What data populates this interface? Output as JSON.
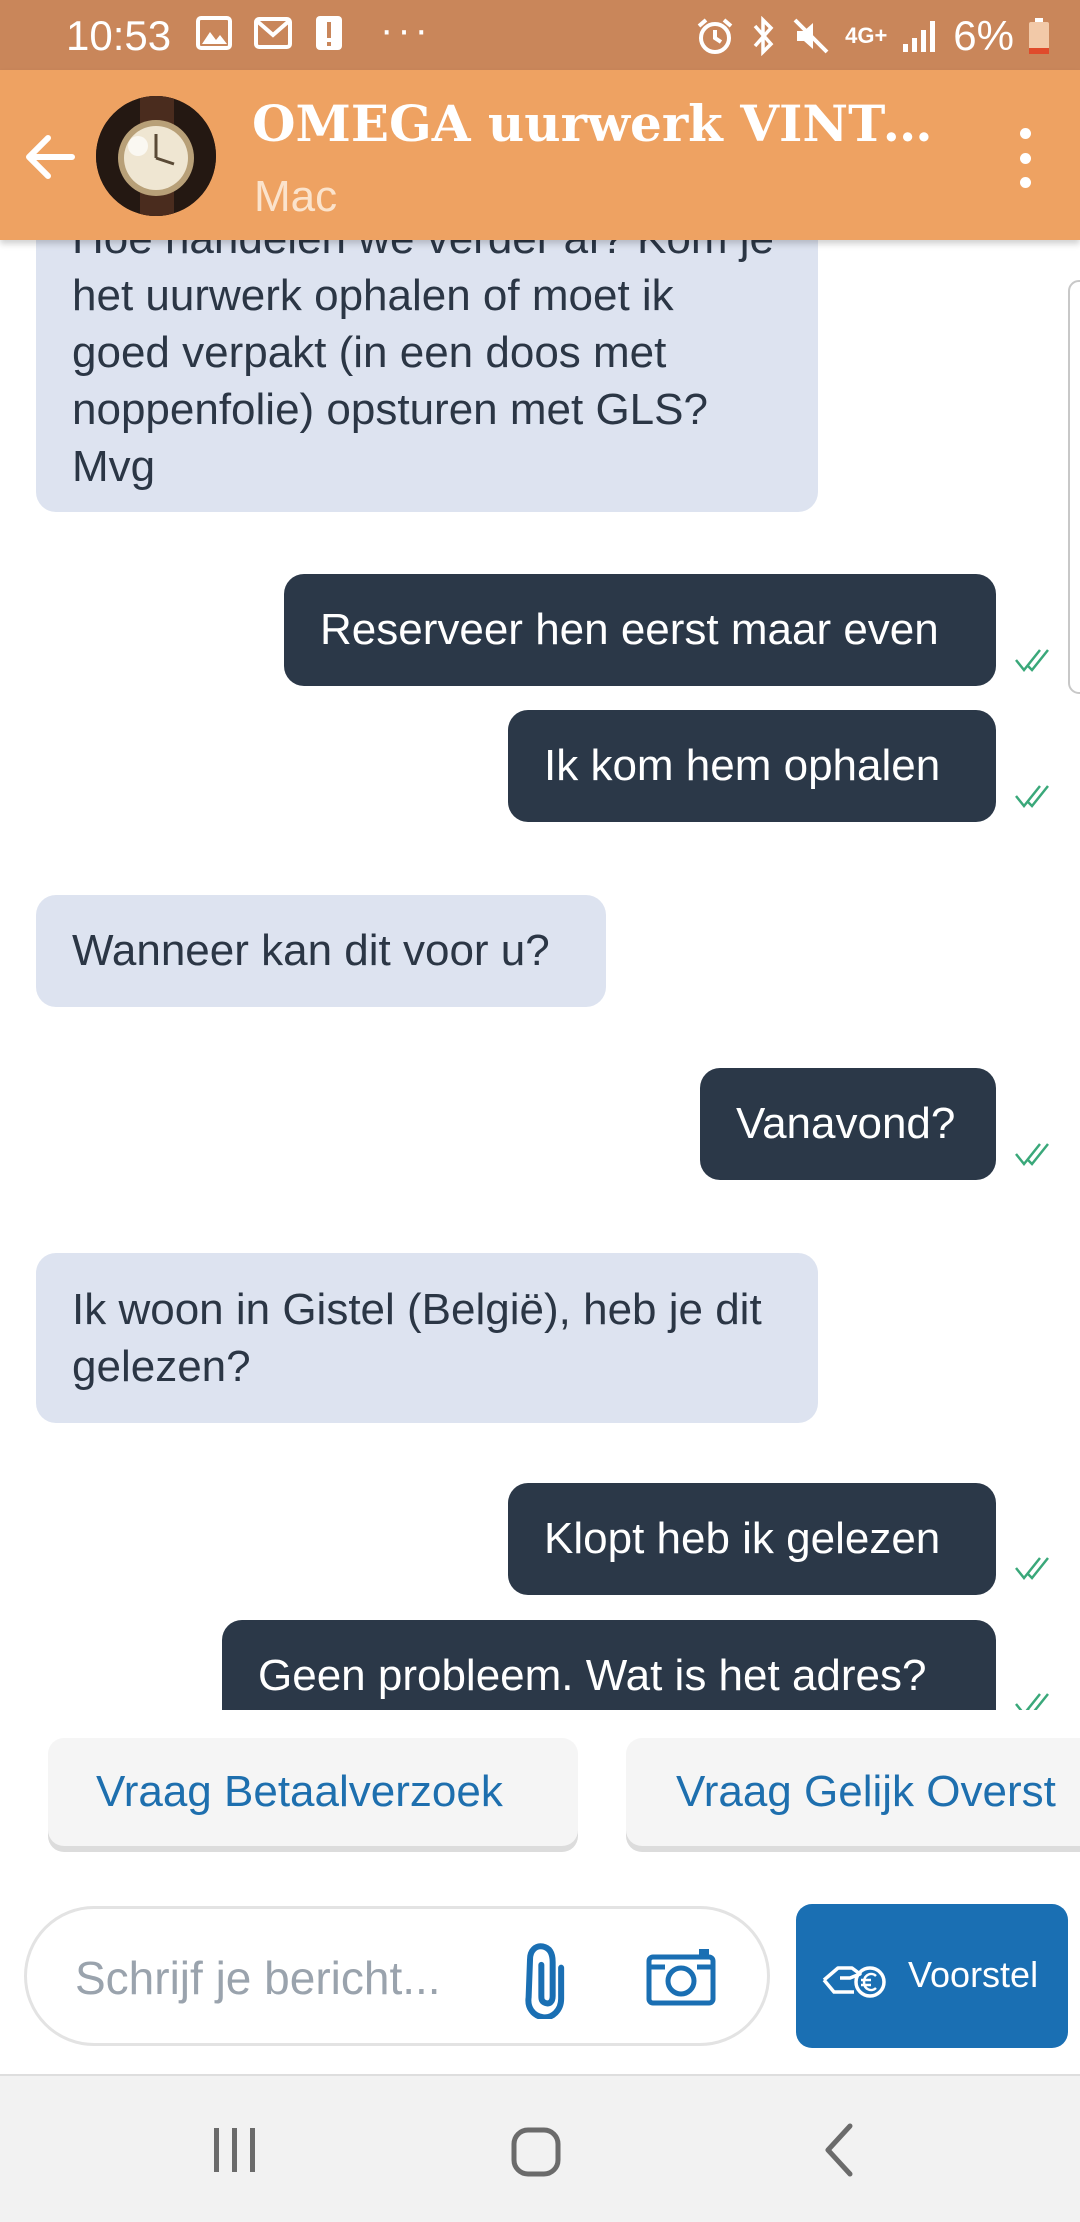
{
  "status_bar": {
    "time": "10:53",
    "network": "4G+",
    "battery": "6%",
    "overflow": "···"
  },
  "header": {
    "title": "OMEGA uurwerk VINTA...",
    "subtitle": "Mac"
  },
  "messages": [
    {
      "direction": "incoming",
      "text": "Hoe handelen we verder af? Kom je het uurwerk ophalen of moet ik goed verpakt (in een doos met noppenfolie) opsturen met GLS? Mvg"
    },
    {
      "direction": "outgoing",
      "text": "Reserveer hen eerst maar even",
      "status": "read"
    },
    {
      "direction": "outgoing",
      "text": "Ik kom hem ophalen",
      "status": "read"
    },
    {
      "direction": "incoming",
      "text": "Wanneer kan dit voor u?"
    },
    {
      "direction": "outgoing",
      "text": "Vanavond?",
      "status": "read"
    },
    {
      "direction": "incoming",
      "text": "Ik woon in Gistel (België), heb je dit gelezen?"
    },
    {
      "direction": "outgoing",
      "text": "Klopt heb ik gelezen",
      "status": "read"
    },
    {
      "direction": "outgoing",
      "text": "Geen probleem. Wat is het adres?",
      "status": "read"
    }
  ],
  "quick_replies": [
    "Vraag Betaalverzoek",
    "Vraag Gelijk Overst"
  ],
  "composer": {
    "placeholder": "Schrijf je bericht...",
    "voorstel_label": "Voorstel"
  },
  "colors": {
    "status_bar": "#c9865a",
    "app_bar": "#eea262",
    "incoming_bubble": "#dde3f0",
    "outgoing_bubble": "#2b3848",
    "accent_blue": "#1a6fb3",
    "read_tick": "#3aa87a"
  }
}
